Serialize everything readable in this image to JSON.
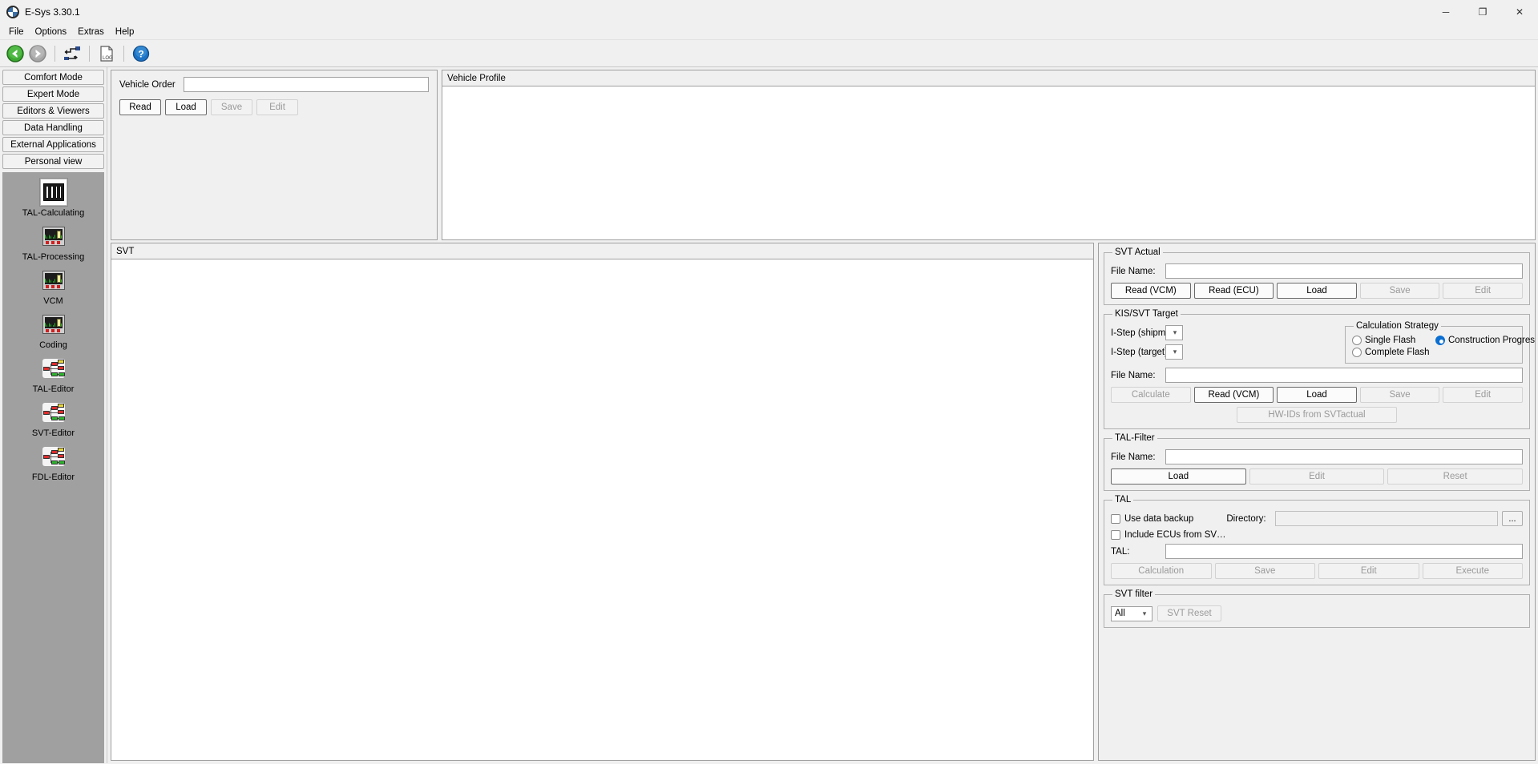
{
  "window": {
    "title": "E-Sys 3.30.1",
    "app_icon": "bmw-logo-icon",
    "minimize": "─",
    "maximize": "❐",
    "close": "✕"
  },
  "menubar": {
    "items": [
      {
        "label": "File"
      },
      {
        "label": "Options"
      },
      {
        "label": "Extras"
      },
      {
        "label": "Help"
      }
    ]
  },
  "toolbar": {
    "buttons": [
      {
        "name": "back-button",
        "icon": "green-left-arrow-icon"
      },
      {
        "name": "forward-button",
        "icon": "gray-right-arrow-icon"
      },
      {
        "name": "connection-button",
        "icon": "connect-icon"
      },
      {
        "name": "log-button",
        "icon": "log-document-icon"
      },
      {
        "name": "help-button",
        "icon": "blue-question-help-icon"
      }
    ]
  },
  "sidebar": {
    "modes": [
      {
        "label": "Comfort Mode"
      },
      {
        "label": "Expert Mode"
      },
      {
        "label": "Editors & Viewers"
      },
      {
        "label": "Data Handling"
      },
      {
        "label": "External Applications"
      },
      {
        "label": "Personal view"
      }
    ],
    "icons": [
      {
        "label": "TAL-Calculating",
        "icon": "chip-icon",
        "selected": true
      },
      {
        "label": "TAL-Processing",
        "icon": "oscilloscope-icon",
        "selected": false
      },
      {
        "label": "VCM",
        "icon": "oscilloscope-icon",
        "selected": false
      },
      {
        "label": "Coding",
        "icon": "oscilloscope-icon",
        "selected": false
      },
      {
        "label": "TAL-Editor",
        "icon": "node-tree-icon",
        "selected": false
      },
      {
        "label": "SVT-Editor",
        "icon": "node-tree-icon",
        "selected": false
      },
      {
        "label": "FDL-Editor",
        "icon": "node-tree-icon",
        "selected": false
      }
    ]
  },
  "vehicle_order": {
    "label": "Vehicle Order",
    "value": "",
    "buttons": [
      {
        "label": "Read",
        "disabled": false
      },
      {
        "label": "Load",
        "disabled": false
      },
      {
        "label": "Save",
        "disabled": true
      },
      {
        "label": "Edit",
        "disabled": true
      }
    ]
  },
  "vehicle_profile": {
    "header": "Vehicle Profile"
  },
  "svt": {
    "header": "SVT"
  },
  "svt_actual": {
    "legend": "SVT Actual",
    "file_name_label": "File Name:",
    "file_name_value": "",
    "buttons": [
      {
        "label": "Read (VCM)",
        "disabled": false,
        "default": true
      },
      {
        "label": "Read (ECU)",
        "disabled": false,
        "default": true
      },
      {
        "label": "Load",
        "disabled": false,
        "default": true
      },
      {
        "label": "Save",
        "disabled": true,
        "default": false
      },
      {
        "label": "Edit",
        "disabled": true,
        "default": false
      }
    ]
  },
  "kis_svt_target": {
    "legend": "KIS/SVT Target",
    "istep_shipm_label": "I-Step (shipm.):",
    "istep_shipm_value": "",
    "istep_target_label": "I-Step (target):",
    "istep_target_value": "",
    "file_name_label": "File Name:",
    "file_name_value": "",
    "calculation_strategy": {
      "legend": "Calculation Strategy",
      "options": [
        {
          "label": "Single Flash",
          "selected": false
        },
        {
          "label": "Construction Progress",
          "selected": true
        },
        {
          "label": "Complete Flash",
          "selected": false
        }
      ]
    },
    "buttons": [
      {
        "label": "Calculate",
        "disabled": true,
        "default": false
      },
      {
        "label": "Read (VCM)",
        "disabled": false,
        "default": true
      },
      {
        "label": "Load",
        "disabled": false,
        "default": true
      },
      {
        "label": "Save",
        "disabled": true,
        "default": false
      },
      {
        "label": "Edit",
        "disabled": true,
        "default": false
      }
    ],
    "hwids_button": {
      "label": "HW-IDs from SVTactual",
      "disabled": true
    }
  },
  "tal_filter": {
    "legend": "TAL-Filter",
    "file_name_label": "File Name:",
    "file_name_value": "",
    "buttons": [
      {
        "label": "Load",
        "disabled": false,
        "default": true
      },
      {
        "label": "Edit",
        "disabled": true,
        "default": false
      },
      {
        "label": "Reset",
        "disabled": true,
        "default": false
      }
    ]
  },
  "tal": {
    "legend": "TAL",
    "use_data_backup": {
      "label": "Use data backup",
      "checked": false
    },
    "include_ecus": {
      "label": "Include ECUs from SV…",
      "checked": false
    },
    "directory_label": "Directory:",
    "directory_value": "",
    "browse_button": "...",
    "tal_label": "TAL:",
    "tal_value": "",
    "buttons": [
      {
        "label": "Calculation",
        "disabled": true
      },
      {
        "label": "Save",
        "disabled": true
      },
      {
        "label": "Edit",
        "disabled": true
      },
      {
        "label": "Execute",
        "disabled": true
      }
    ]
  },
  "svt_filter": {
    "legend": "SVT filter",
    "selected_option": "All",
    "reset_button": {
      "label": "SVT Reset",
      "disabled": true
    }
  },
  "colors": {
    "accent": "#0b6ed1",
    "window_bg": "#f0f0f0",
    "panel_border": "#a0a0a0",
    "icon_panel_bg": "#a0a0a0"
  }
}
